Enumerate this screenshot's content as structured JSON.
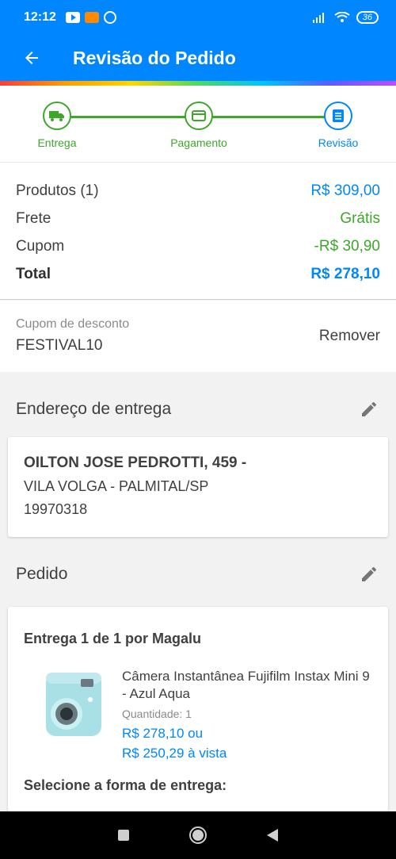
{
  "status_bar": {
    "time": "12:12",
    "battery": "36"
  },
  "app_bar": {
    "title": "Revisão do Pedido"
  },
  "steps": [
    {
      "label": "Entrega",
      "icon": "truck-icon",
      "state": "done"
    },
    {
      "label": "Pagamento",
      "icon": "card-icon",
      "state": "done"
    },
    {
      "label": "Revisão",
      "icon": "review-list-icon",
      "state": "current"
    }
  ],
  "summary": {
    "products_label": "Produtos (1)",
    "products_value": "R$ 309,00",
    "shipping_label": "Frete",
    "shipping_value": "Grátis",
    "coupon_label": "Cupom",
    "coupon_value": "-R$ 30,90",
    "total_label": "Total",
    "total_value": "R$ 278,10"
  },
  "coupon": {
    "label": "Cupom de desconto",
    "code": "FESTIVAL10",
    "remove_label": "Remover"
  },
  "address_section": {
    "title": "Endereço de entrega",
    "line1": "OILTON JOSE PEDROTTI, 459 -",
    "line2": "VILA VOLGA - PALMITAL/SP",
    "zip": "19970318"
  },
  "order_section": {
    "title": "Pedido",
    "delivery": "Entrega 1 de 1 por Magalu",
    "product": {
      "name": "Câmera Instantânea Fujifilm Instax Mini 9 - Azul Aqua",
      "quantity": "Quantidade:  1",
      "price_line1": "R$ 278,10 ou",
      "price_line2": "R$ 250,29 à vista"
    },
    "select_delivery": "Selecione a forma de entrega:"
  },
  "colors": {
    "primary": "#0086ff",
    "success": "#3fa62c"
  }
}
